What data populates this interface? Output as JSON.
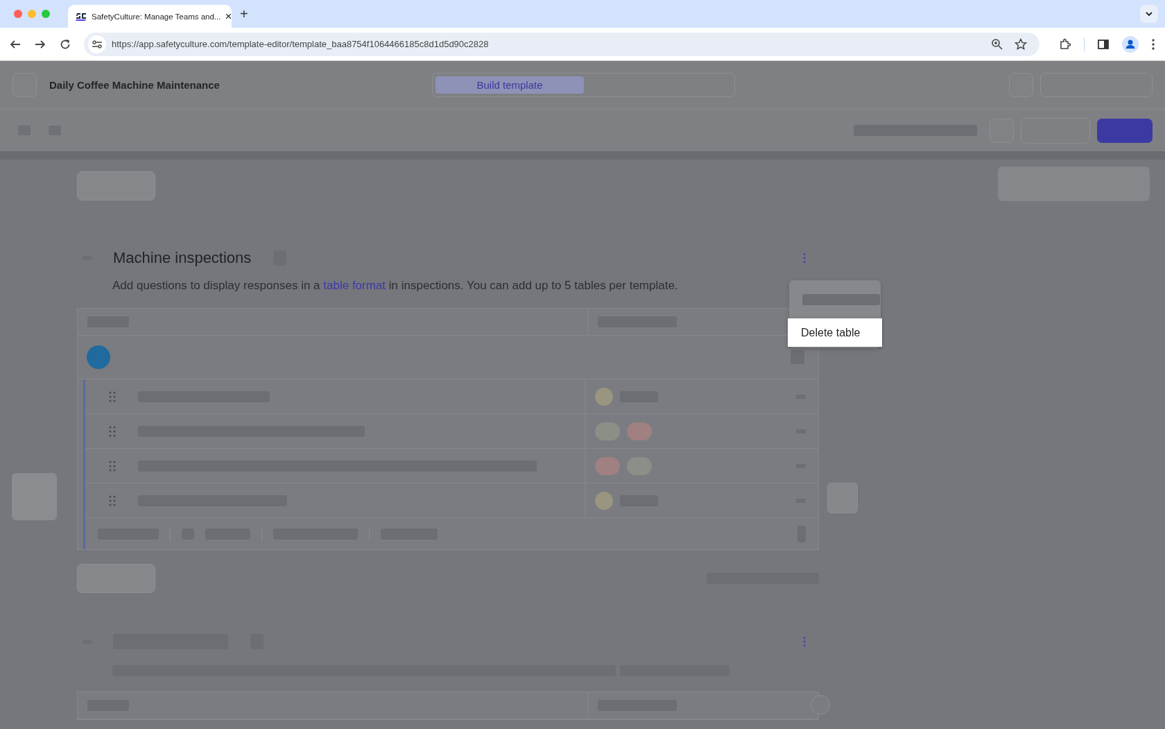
{
  "browser": {
    "tab_title": "SafetyCulture: Manage Teams and...",
    "tab_close": "×",
    "new_tab": "+",
    "url": "https://app.safetyculture.com/template-editor/template_baa8754f1064466185c8d1d5d90c2828"
  },
  "header": {
    "title": "Daily Coffee Machine Maintenance",
    "tabs": [
      {
        "label": "Build template",
        "selected": true
      }
    ]
  },
  "section": {
    "title": "Machine inspections",
    "description_before": "Add questions to display responses in a ",
    "link": "table format",
    "description_after": " in inspections. You can add up to 5 tables per template."
  },
  "menu": {
    "items": [
      {
        "label": "Delete table",
        "selected": true
      }
    ]
  }
}
